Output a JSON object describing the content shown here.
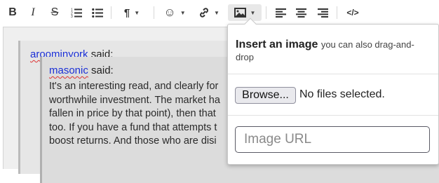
{
  "toolbar": {
    "bold_icon": "B",
    "italic_icon": "I",
    "strike_icon": "S",
    "ordered_list_icon": "ordered-list-icon",
    "unordered_list_icon": "unordered-list-icon",
    "paragraph_icon": "¶",
    "smilie_icon": "☺",
    "link_icon": "link-icon",
    "image_icon": "image-icon",
    "align_left_icon": "align-left-icon",
    "align_center_icon": "align-center-icon",
    "align_right_icon": "align-right-icon",
    "source_icon": "</>"
  },
  "quote_outer": {
    "author": "aroominyork",
    "said": " said:"
  },
  "quote_inner": {
    "author": "masonic",
    "said": " said:",
    "lines": [
      "It's an interesting read, and clearly for",
      "worthwhile investment. The market ha",
      "fallen in price by that point), then that",
      "too. If you have a fund that attempts t",
      "boost returns. And those who are disi"
    ]
  },
  "image_popup": {
    "title": "Insert an image",
    "subtitle": "you can also drag-and-drop",
    "browse_label": "Browse...",
    "no_file_text": "No files selected.",
    "url_placeholder": "Image URL"
  },
  "colors": {
    "username": "#1a2fd6",
    "editor_bg": "#efefef",
    "quote_bg": "#e6e6e6",
    "nested_quote_bg": "#dcdcdc"
  }
}
